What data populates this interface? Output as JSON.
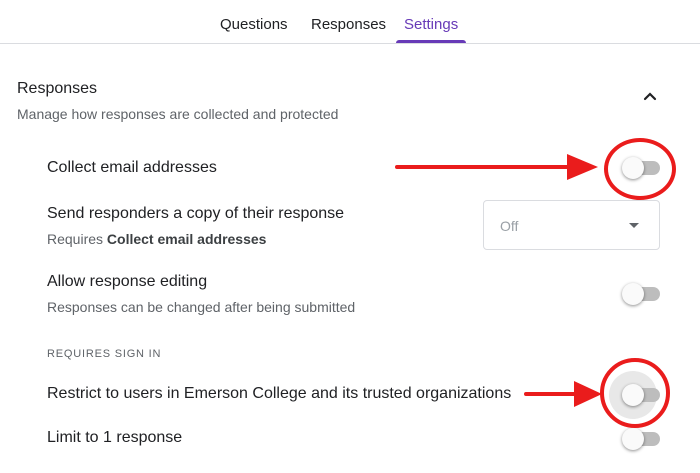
{
  "tabs": [
    {
      "label": "Questions"
    },
    {
      "label": "Responses"
    },
    {
      "label": "Settings"
    }
  ],
  "active_tab": "Settings",
  "accent_color": "#673ab7",
  "annotation_color": "#ea1c1c",
  "section": {
    "title": "Responses",
    "subtitle": "Manage how responses are collected and protected",
    "collapse_icon": "chevron-up-icon"
  },
  "settings": {
    "collect_email": {
      "label": "Collect email addresses",
      "enabled": false
    },
    "send_copy": {
      "label": "Send responders a copy of their response",
      "requires_prefix": "Requires",
      "requires_target": "Collect email addresses",
      "select_value": "Off"
    },
    "allow_editing": {
      "label": "Allow response editing",
      "description": "Responses can be changed after being submitted",
      "enabled": false
    },
    "sign_in_header": "REQUIRES SIGN IN",
    "restrict_users": {
      "label": "Restrict to users in Emerson College and its trusted organizations",
      "enabled": false
    },
    "limit_one": {
      "label": "Limit to 1 response",
      "enabled": false
    }
  }
}
